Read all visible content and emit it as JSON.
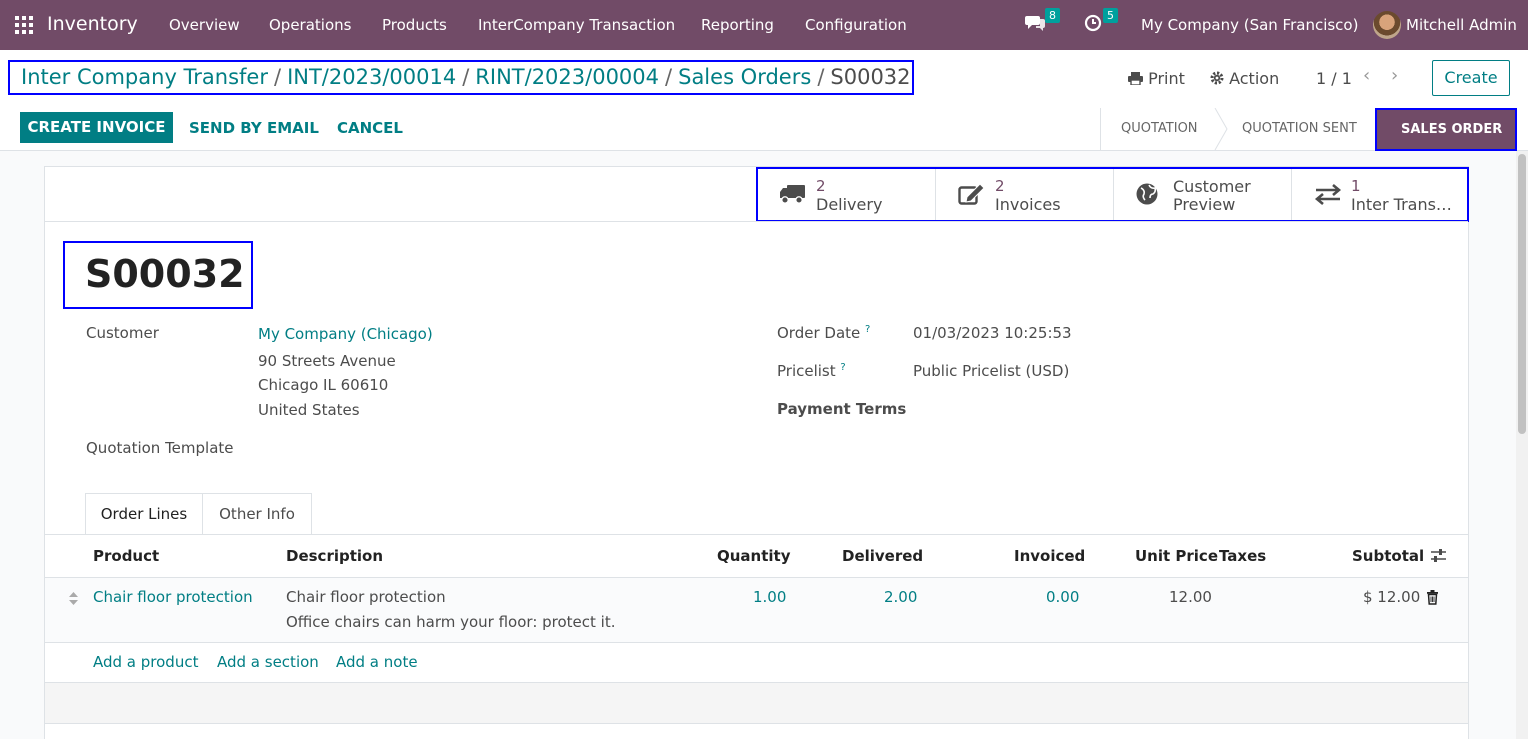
{
  "app": {
    "name": "Inventory"
  },
  "menu": [
    "Overview",
    "Operations",
    "Products",
    "InterCompany Transaction",
    "Reporting",
    "Configuration"
  ],
  "systray": {
    "messages_count": "8",
    "activities_count": "5",
    "company": "My Company (San Francisco)",
    "user": "Mitchell Admin"
  },
  "breadcrumb": [
    "Inter Company Transfer",
    "INT/2023/00014",
    "RINT/2023/00004",
    "Sales Orders",
    "S00032"
  ],
  "toolbar": {
    "print": "Print",
    "action": "Action",
    "pager": "1 / 1",
    "create": "Create"
  },
  "actions": {
    "create_invoice": "CREATE INVOICE",
    "send_email": "SEND BY EMAIL",
    "cancel": "CANCEL"
  },
  "stages": {
    "quotation": "QUOTATION",
    "quotation_sent": "QUOTATION SENT",
    "sales_order": "SALES ORDER"
  },
  "smart_buttons": {
    "delivery": {
      "count": "2",
      "label": "Delivery"
    },
    "invoices": {
      "count": "2",
      "label": "Invoices"
    },
    "preview": {
      "line1": "Customer",
      "line2": "Preview"
    },
    "inter": {
      "count": "1",
      "label": "Inter Trans…"
    }
  },
  "record": {
    "name": "S00032"
  },
  "fields": {
    "customer_label": "Customer",
    "customer_name": "My Company (Chicago)",
    "address1": "90 Streets Avenue",
    "address2": "Chicago IL 60610",
    "address3": "United States",
    "template_label": "Quotation Template",
    "order_date_label": "Order Date",
    "order_date": "01/03/2023 10:25:53",
    "pricelist_label": "Pricelist",
    "pricelist": "Public Pricelist (USD)",
    "payment_terms_label": "Payment Terms",
    "help_mark": "?"
  },
  "tabs": {
    "order_lines": "Order Lines",
    "other_info": "Other Info"
  },
  "table": {
    "headers": {
      "product": "Product",
      "description": "Description",
      "quantity": "Quantity",
      "delivered": "Delivered",
      "invoiced": "Invoiced",
      "unit_price": "Unit Price",
      "taxes": "Taxes",
      "subtotal": "Subtotal"
    },
    "rows": [
      {
        "product": "Chair floor protection",
        "description": "Chair floor protection",
        "description2": "Office chairs can harm your floor: protect it.",
        "quantity": "1.00",
        "delivered": "2.00",
        "invoiced": "0.00",
        "unit_price": "12.00",
        "subtotal": "$ 12.00"
      }
    ],
    "add_product": "Add a product",
    "add_section": "Add a section",
    "add_note": "Add a note"
  }
}
